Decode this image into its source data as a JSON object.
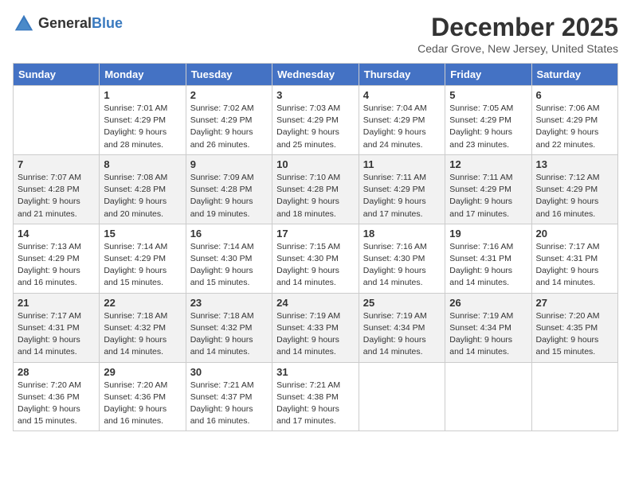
{
  "header": {
    "logo_general": "General",
    "logo_blue": "Blue",
    "month": "December 2025",
    "location": "Cedar Grove, New Jersey, United States"
  },
  "weekdays": [
    "Sunday",
    "Monday",
    "Tuesday",
    "Wednesday",
    "Thursday",
    "Friday",
    "Saturday"
  ],
  "weeks": [
    [
      {
        "day": "",
        "sunrise": "",
        "sunset": "",
        "daylight": ""
      },
      {
        "day": "1",
        "sunrise": "Sunrise: 7:01 AM",
        "sunset": "Sunset: 4:29 PM",
        "daylight": "Daylight: 9 hours and 28 minutes."
      },
      {
        "day": "2",
        "sunrise": "Sunrise: 7:02 AM",
        "sunset": "Sunset: 4:29 PM",
        "daylight": "Daylight: 9 hours and 26 minutes."
      },
      {
        "day": "3",
        "sunrise": "Sunrise: 7:03 AM",
        "sunset": "Sunset: 4:29 PM",
        "daylight": "Daylight: 9 hours and 25 minutes."
      },
      {
        "day": "4",
        "sunrise": "Sunrise: 7:04 AM",
        "sunset": "Sunset: 4:29 PM",
        "daylight": "Daylight: 9 hours and 24 minutes."
      },
      {
        "day": "5",
        "sunrise": "Sunrise: 7:05 AM",
        "sunset": "Sunset: 4:29 PM",
        "daylight": "Daylight: 9 hours and 23 minutes."
      },
      {
        "day": "6",
        "sunrise": "Sunrise: 7:06 AM",
        "sunset": "Sunset: 4:29 PM",
        "daylight": "Daylight: 9 hours and 22 minutes."
      }
    ],
    [
      {
        "day": "7",
        "sunrise": "Sunrise: 7:07 AM",
        "sunset": "Sunset: 4:28 PM",
        "daylight": "Daylight: 9 hours and 21 minutes."
      },
      {
        "day": "8",
        "sunrise": "Sunrise: 7:08 AM",
        "sunset": "Sunset: 4:28 PM",
        "daylight": "Daylight: 9 hours and 20 minutes."
      },
      {
        "day": "9",
        "sunrise": "Sunrise: 7:09 AM",
        "sunset": "Sunset: 4:28 PM",
        "daylight": "Daylight: 9 hours and 19 minutes."
      },
      {
        "day": "10",
        "sunrise": "Sunrise: 7:10 AM",
        "sunset": "Sunset: 4:28 PM",
        "daylight": "Daylight: 9 hours and 18 minutes."
      },
      {
        "day": "11",
        "sunrise": "Sunrise: 7:11 AM",
        "sunset": "Sunset: 4:29 PM",
        "daylight": "Daylight: 9 hours and 17 minutes."
      },
      {
        "day": "12",
        "sunrise": "Sunrise: 7:11 AM",
        "sunset": "Sunset: 4:29 PM",
        "daylight": "Daylight: 9 hours and 17 minutes."
      },
      {
        "day": "13",
        "sunrise": "Sunrise: 7:12 AM",
        "sunset": "Sunset: 4:29 PM",
        "daylight": "Daylight: 9 hours and 16 minutes."
      }
    ],
    [
      {
        "day": "14",
        "sunrise": "Sunrise: 7:13 AM",
        "sunset": "Sunset: 4:29 PM",
        "daylight": "Daylight: 9 hours and 16 minutes."
      },
      {
        "day": "15",
        "sunrise": "Sunrise: 7:14 AM",
        "sunset": "Sunset: 4:29 PM",
        "daylight": "Daylight: 9 hours and 15 minutes."
      },
      {
        "day": "16",
        "sunrise": "Sunrise: 7:14 AM",
        "sunset": "Sunset: 4:30 PM",
        "daylight": "Daylight: 9 hours and 15 minutes."
      },
      {
        "day": "17",
        "sunrise": "Sunrise: 7:15 AM",
        "sunset": "Sunset: 4:30 PM",
        "daylight": "Daylight: 9 hours and 14 minutes."
      },
      {
        "day": "18",
        "sunrise": "Sunrise: 7:16 AM",
        "sunset": "Sunset: 4:30 PM",
        "daylight": "Daylight: 9 hours and 14 minutes."
      },
      {
        "day": "19",
        "sunrise": "Sunrise: 7:16 AM",
        "sunset": "Sunset: 4:31 PM",
        "daylight": "Daylight: 9 hours and 14 minutes."
      },
      {
        "day": "20",
        "sunrise": "Sunrise: 7:17 AM",
        "sunset": "Sunset: 4:31 PM",
        "daylight": "Daylight: 9 hours and 14 minutes."
      }
    ],
    [
      {
        "day": "21",
        "sunrise": "Sunrise: 7:17 AM",
        "sunset": "Sunset: 4:31 PM",
        "daylight": "Daylight: 9 hours and 14 minutes."
      },
      {
        "day": "22",
        "sunrise": "Sunrise: 7:18 AM",
        "sunset": "Sunset: 4:32 PM",
        "daylight": "Daylight: 9 hours and 14 minutes."
      },
      {
        "day": "23",
        "sunrise": "Sunrise: 7:18 AM",
        "sunset": "Sunset: 4:32 PM",
        "daylight": "Daylight: 9 hours and 14 minutes."
      },
      {
        "day": "24",
        "sunrise": "Sunrise: 7:19 AM",
        "sunset": "Sunset: 4:33 PM",
        "daylight": "Daylight: 9 hours and 14 minutes."
      },
      {
        "day": "25",
        "sunrise": "Sunrise: 7:19 AM",
        "sunset": "Sunset: 4:34 PM",
        "daylight": "Daylight: 9 hours and 14 minutes."
      },
      {
        "day": "26",
        "sunrise": "Sunrise: 7:19 AM",
        "sunset": "Sunset: 4:34 PM",
        "daylight": "Daylight: 9 hours and 14 minutes."
      },
      {
        "day": "27",
        "sunrise": "Sunrise: 7:20 AM",
        "sunset": "Sunset: 4:35 PM",
        "daylight": "Daylight: 9 hours and 15 minutes."
      }
    ],
    [
      {
        "day": "28",
        "sunrise": "Sunrise: 7:20 AM",
        "sunset": "Sunset: 4:36 PM",
        "daylight": "Daylight: 9 hours and 15 minutes."
      },
      {
        "day": "29",
        "sunrise": "Sunrise: 7:20 AM",
        "sunset": "Sunset: 4:36 PM",
        "daylight": "Daylight: 9 hours and 16 minutes."
      },
      {
        "day": "30",
        "sunrise": "Sunrise: 7:21 AM",
        "sunset": "Sunset: 4:37 PM",
        "daylight": "Daylight: 9 hours and 16 minutes."
      },
      {
        "day": "31",
        "sunrise": "Sunrise: 7:21 AM",
        "sunset": "Sunset: 4:38 PM",
        "daylight": "Daylight: 9 hours and 17 minutes."
      },
      {
        "day": "",
        "sunrise": "",
        "sunset": "",
        "daylight": ""
      },
      {
        "day": "",
        "sunrise": "",
        "sunset": "",
        "daylight": ""
      },
      {
        "day": "",
        "sunrise": "",
        "sunset": "",
        "daylight": ""
      }
    ]
  ]
}
